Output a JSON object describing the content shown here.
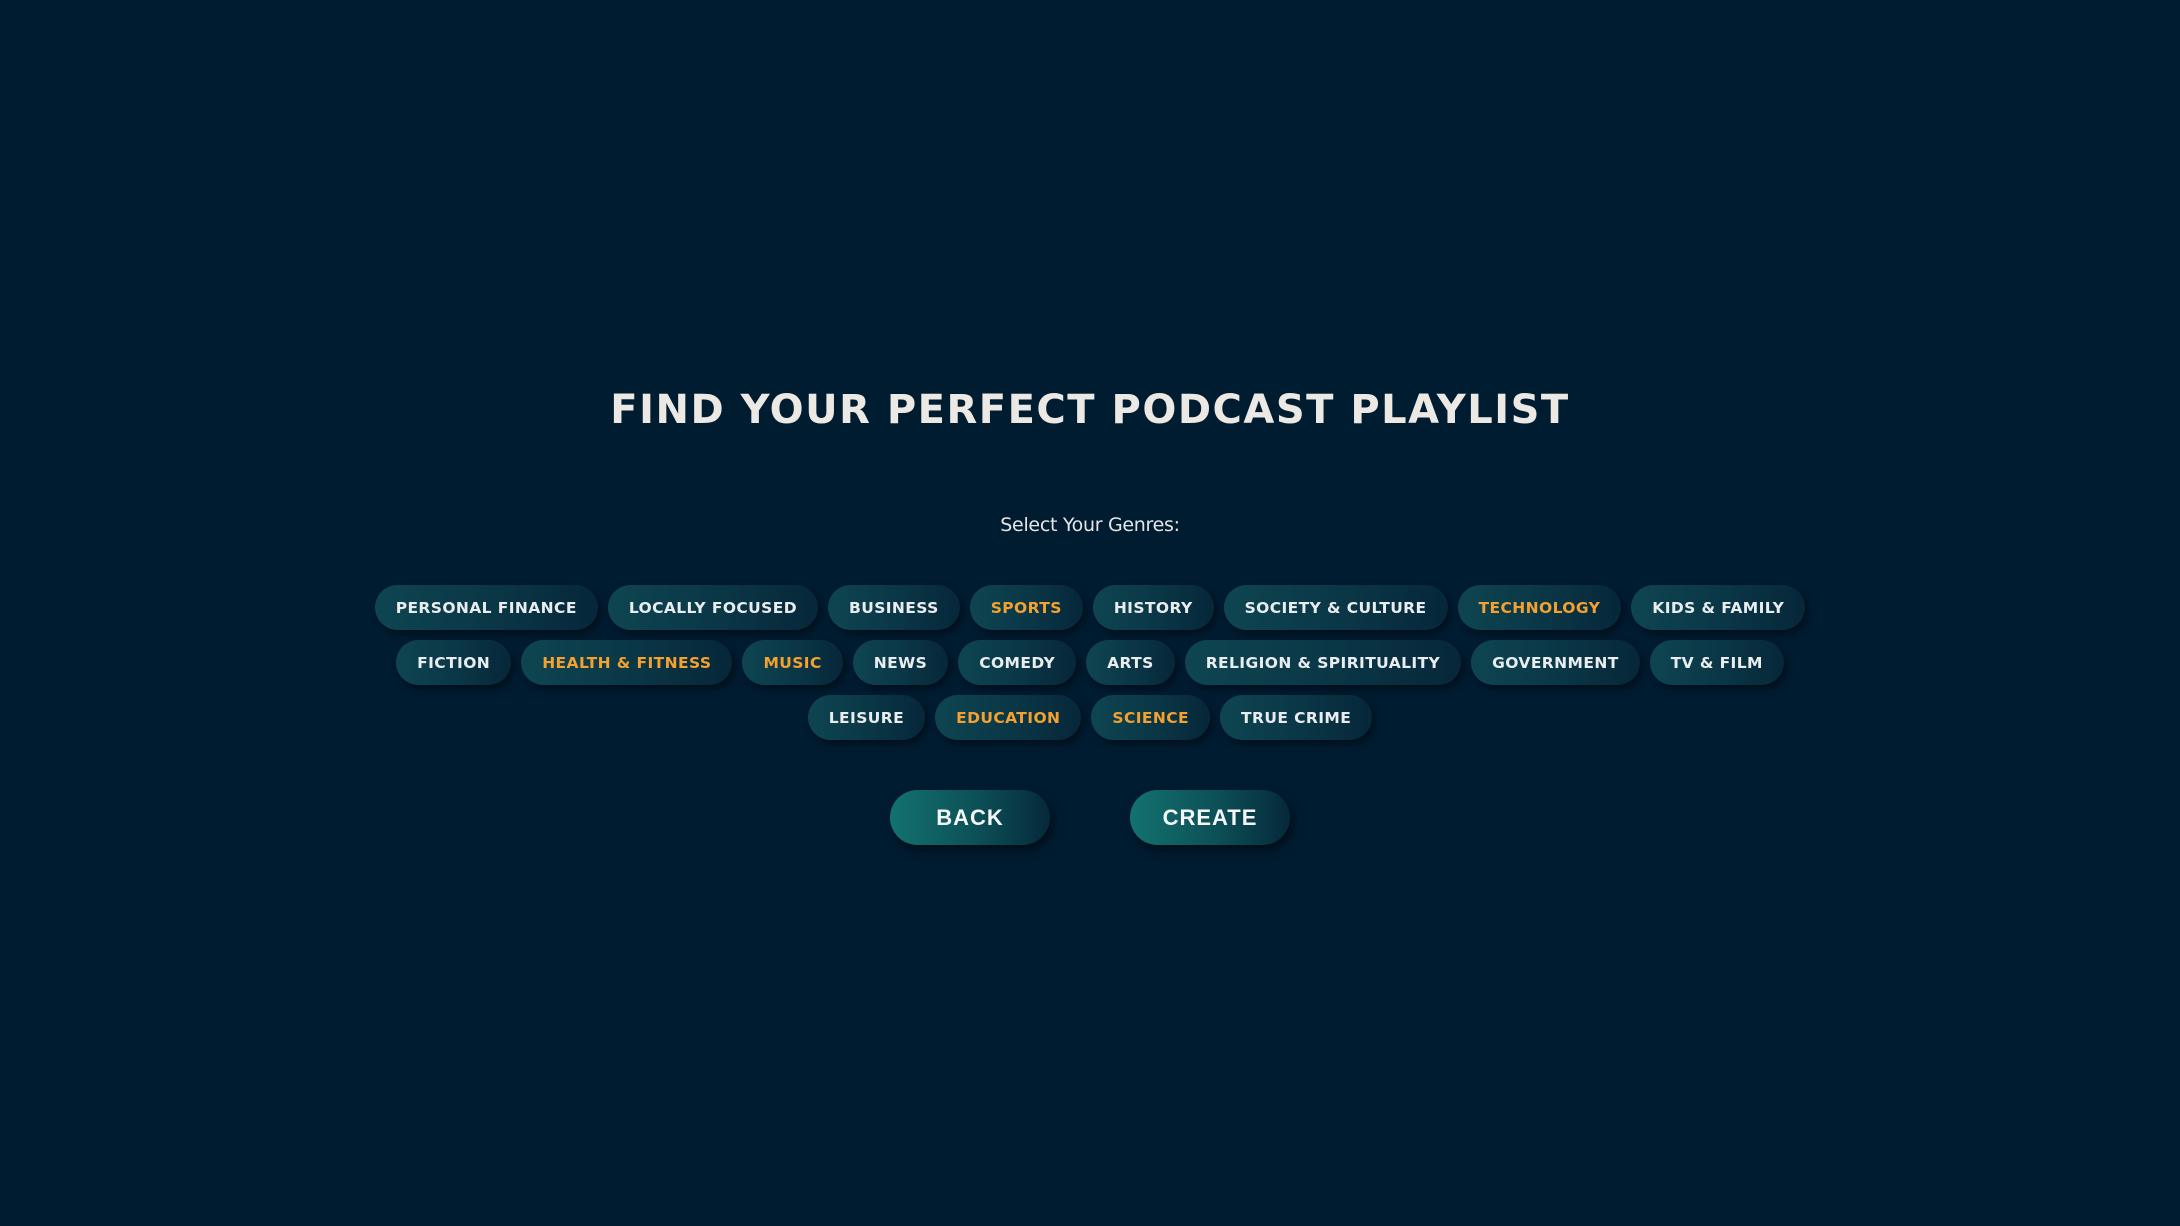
{
  "header": {
    "title": "FIND YOUR PERFECT PODCAST PLAYLIST",
    "subtitle": "Select Your Genres:"
  },
  "colors": {
    "background": "#001c31",
    "pill_text": "#e9edf0",
    "selected_text": "#f4a130",
    "button_gradient_start": "#13726f",
    "button_gradient_end": "#05293a"
  },
  "genres": [
    {
      "label": "PERSONAL FINANCE",
      "selected": false
    },
    {
      "label": "LOCALLY FOCUSED",
      "selected": false
    },
    {
      "label": "BUSINESS",
      "selected": false
    },
    {
      "label": "SPORTS",
      "selected": true
    },
    {
      "label": "HISTORY",
      "selected": false
    },
    {
      "label": "SOCIETY & CULTURE",
      "selected": false
    },
    {
      "label": "TECHNOLOGY",
      "selected": true
    },
    {
      "label": "KIDS & FAMILY",
      "selected": false
    },
    {
      "label": "FICTION",
      "selected": false
    },
    {
      "label": "HEALTH & FITNESS",
      "selected": true
    },
    {
      "label": "MUSIC",
      "selected": true
    },
    {
      "label": "NEWS",
      "selected": false
    },
    {
      "label": "COMEDY",
      "selected": false
    },
    {
      "label": "ARTS",
      "selected": false
    },
    {
      "label": "RELIGION & SPIRITUALITY",
      "selected": false
    },
    {
      "label": "GOVERNMENT",
      "selected": false
    },
    {
      "label": "TV & FILM",
      "selected": false
    },
    {
      "label": "LEISURE",
      "selected": false
    },
    {
      "label": "EDUCATION",
      "selected": true
    },
    {
      "label": "SCIENCE",
      "selected": true
    },
    {
      "label": "TRUE CRIME",
      "selected": false
    }
  ],
  "actions": {
    "back_label": "BACK",
    "create_label": "CREATE"
  }
}
